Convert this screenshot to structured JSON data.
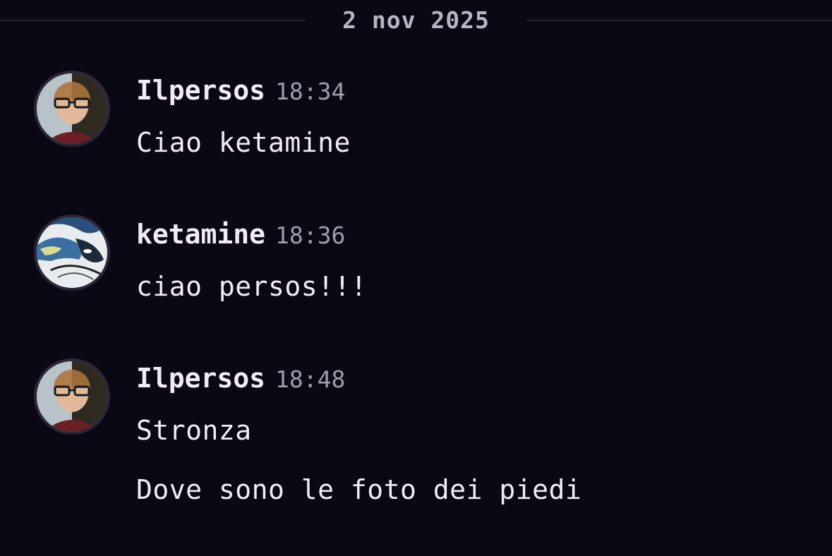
{
  "date_divider": "2 nov 2025",
  "messages": [
    {
      "author": "Ilpersos",
      "time": "18:34",
      "lines": [
        "Ciao ketamine"
      ]
    },
    {
      "author": "ketamine",
      "time": "18:36",
      "lines": [
        "ciao persos!!!"
      ]
    },
    {
      "author": "Ilpersos",
      "time": "18:48",
      "lines": [
        "Stronza",
        "Dove sono le foto dei piedi"
      ]
    }
  ],
  "colors": {
    "background": "#0a0812",
    "divider_line": "#24212e",
    "text_primary": "#f2ecf6",
    "text_muted": "#a29cae"
  }
}
